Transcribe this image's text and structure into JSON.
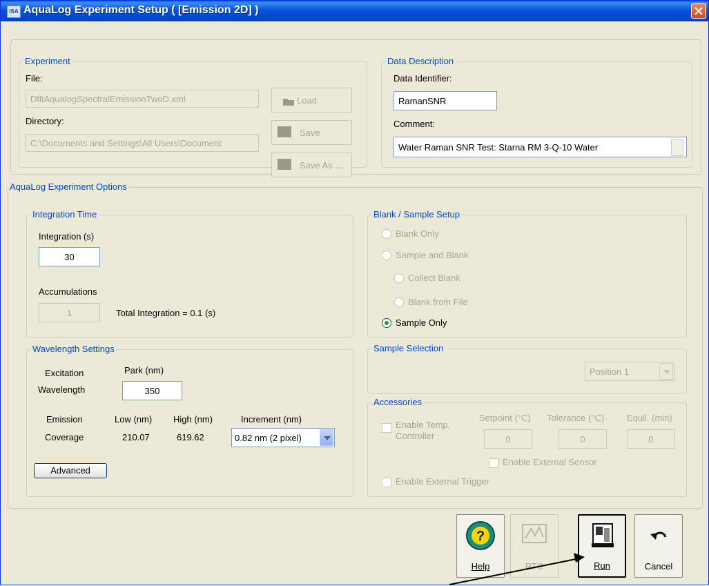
{
  "window": {
    "title": "AquaLog Experiment Setup ( [Emission 2D] )",
    "app_icon": "app-icon"
  },
  "experiment": {
    "legend": "Experiment",
    "file_label": "File:",
    "file_value": "DfltAqualogSpectralEmissionTwoD.xml",
    "directory_label": "Directory:",
    "directory_value": "C:\\Documents and Settings\\All Users\\Document",
    "load_label": "Load",
    "save_label": "Save",
    "save_as_label": "Save As ..."
  },
  "data_description": {
    "legend": "Data Description",
    "identifier_label": "Data Identifier:",
    "identifier_value": "RamanSNR",
    "comment_label": "Comment:",
    "comment_value": "Water Raman SNR Test: Starna RM 3-Q-10 Water"
  },
  "options": {
    "legend": "AquaLog Experiment Options",
    "integration": {
      "legend": "Integration Time",
      "integration_label": "Integration (s)",
      "integration_value": "30",
      "accumulations_label": "Accumulations",
      "accumulations_value": "1",
      "total_label": "Total Integration = 0.1 (s)"
    },
    "wavelength": {
      "legend": "Wavelength Settings",
      "excitation_label": "Excitation",
      "wavelength_label": "Wavelength",
      "park_label": "Park (nm)",
      "park_value": "350",
      "emission_label": "Emission",
      "coverage_label": "Coverage",
      "low_label": "Low (nm)",
      "low_value": "210.07",
      "high_label": "High (nm)",
      "high_value": "619.62",
      "increment_label": "Increment (nm)",
      "increment_value": "0.82 nm (2 pixel)",
      "advanced_label": "Advanced"
    },
    "blank_sample": {
      "legend": "Blank / Sample Setup",
      "options": [
        "Blank Only",
        "Sample and Blank",
        "Collect Blank",
        "Blank from File",
        "Sample Only"
      ],
      "selected": "Sample Only"
    },
    "sample_selection": {
      "legend": "Sample Selection",
      "position_value": "Position 1"
    },
    "accessories": {
      "legend": "Accessories",
      "enable_temp_label_1": "Enable Temp.",
      "enable_temp_label_2": "Controller",
      "setpoint_label": "Setpoint (°C)",
      "setpoint_value": "0",
      "tolerance_label": "Tolerance (°C)",
      "tolerance_value": "0",
      "equil_label": "Equil. (min)",
      "equil_value": "0",
      "external_sensor_label": "Enable External Sensor",
      "external_trigger_label": "Enable External Trigger"
    }
  },
  "buttons": {
    "help": "Help",
    "rtc": "RTC",
    "run": "Run",
    "cancel": "Cancel"
  },
  "colors": {
    "legend": "#0046D5",
    "titlebar": "#0855DD",
    "disabled": "#A7A698"
  }
}
